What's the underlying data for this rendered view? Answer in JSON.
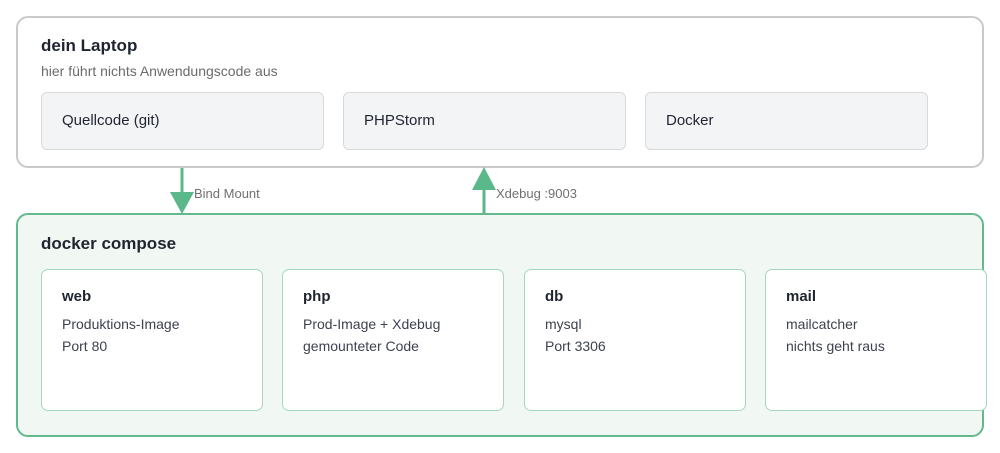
{
  "laptop": {
    "title": "dein Laptop",
    "subtitle": "hier führt nichts Anwendungscode aus",
    "tools": [
      {
        "label": "Quellcode (git)"
      },
      {
        "label": "PHPStorm"
      },
      {
        "label": "Docker"
      }
    ]
  },
  "compose": {
    "title": "docker compose",
    "services": [
      {
        "name": "web",
        "line1": "Produktions-Image",
        "line2": "Port 80"
      },
      {
        "name": "php",
        "line1": "Prod-Image + Xdebug",
        "line2": "gemounteter Code"
      },
      {
        "name": "db",
        "line1": "mysql",
        "line2": "Port 3306"
      },
      {
        "name": "mail",
        "line1": "mailcatcher",
        "line2": "nichts geht raus"
      }
    ]
  },
  "connections": [
    {
      "label": "Bind Mount",
      "direction": "down",
      "from": "Quellcode (git)",
      "to": "docker compose"
    },
    {
      "label": "Xdebug :9003",
      "direction": "up",
      "from": "docker compose",
      "to": "PHPStorm"
    }
  ],
  "colors": {
    "accent": "#5bb88a",
    "compose_bg": "#f1f8f3",
    "compose_border": "#63b98c",
    "laptop_border": "#c9c9c9",
    "tool_bg": "#f3f4f6"
  }
}
